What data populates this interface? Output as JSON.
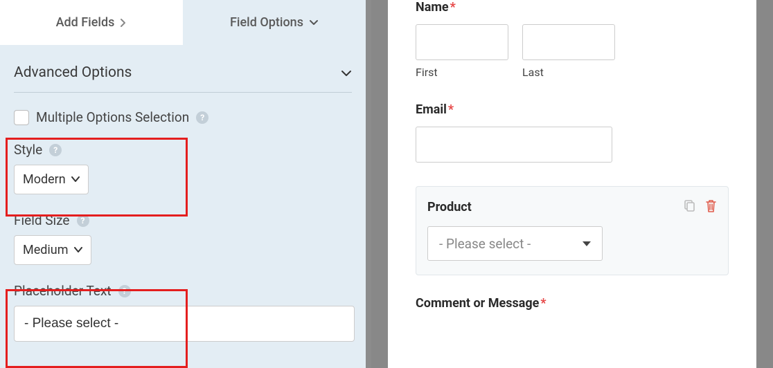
{
  "sidebar": {
    "tabs": {
      "add_fields": "Add Fields",
      "field_options": "Field Options"
    },
    "section_title": "Advanced Options",
    "multiple_options": "Multiple Options Selection",
    "style": {
      "label": "Style",
      "value": "Modern"
    },
    "field_size": {
      "label": "Field Size",
      "value": "Medium"
    },
    "placeholder_text": {
      "label": "Placeholder Text",
      "value": "- Please select -"
    }
  },
  "preview": {
    "name": {
      "label": "Name",
      "first": "First",
      "last": "Last"
    },
    "email": {
      "label": "Email"
    },
    "product": {
      "label": "Product",
      "placeholder": "- Please select -"
    },
    "comment": {
      "label": "Comment or Message"
    }
  }
}
